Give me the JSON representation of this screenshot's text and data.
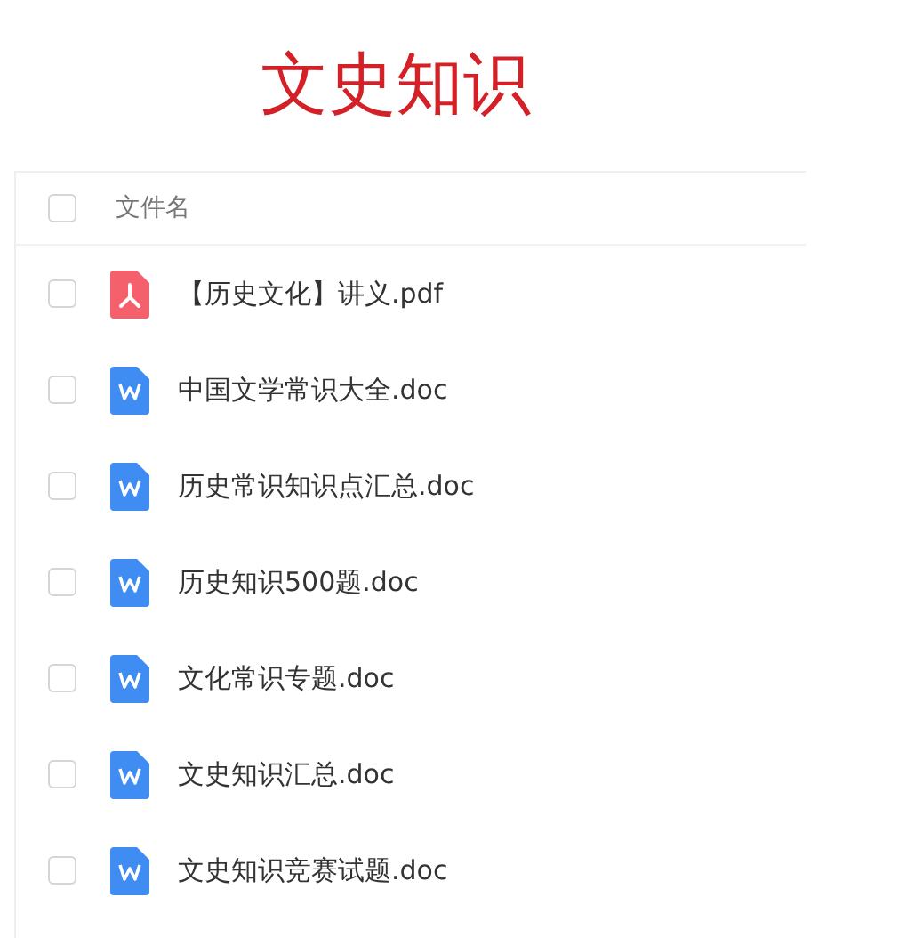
{
  "title": "文史知识",
  "header": {
    "label": "文件名",
    "checked": false
  },
  "files": [
    {
      "name": "【历史文化】讲义.pdf",
      "kind": "pdf",
      "checked": false
    },
    {
      "name": "中国文学常识大全.doc",
      "kind": "doc",
      "checked": false
    },
    {
      "name": "历史常识知识点汇总.doc",
      "kind": "doc",
      "checked": false
    },
    {
      "name": "历史知识500题.doc",
      "kind": "doc",
      "checked": false
    },
    {
      "name": "文化常识专题.doc",
      "kind": "doc",
      "checked": false
    },
    {
      "name": "文史知识汇总.doc",
      "kind": "doc",
      "checked": false
    },
    {
      "name": "文史知识竞赛试题.doc",
      "kind": "doc",
      "checked": false
    }
  ]
}
